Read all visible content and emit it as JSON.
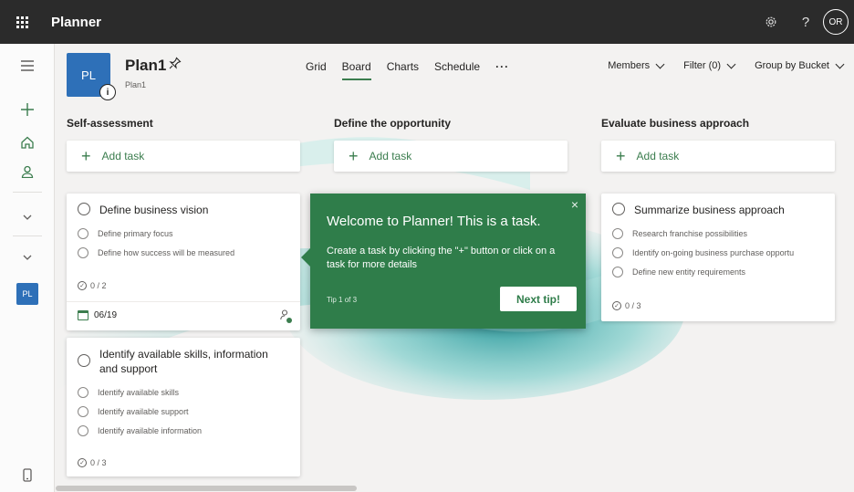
{
  "app": {
    "title": "Planner",
    "user_initials": "OR"
  },
  "topbar": {
    "settings_icon": "gear-icon",
    "help_icon": "?"
  },
  "leftrail": {
    "plan_badge": "PL"
  },
  "plan": {
    "tile": "PL",
    "name": "Plan1",
    "sub": "Plan1",
    "info_glyph": "i"
  },
  "tabs": [
    {
      "label": "Grid"
    },
    {
      "label": "Board"
    },
    {
      "label": "Charts"
    },
    {
      "label": "Schedule"
    }
  ],
  "tabs_more": "···",
  "header_right": {
    "members": "Members",
    "filter": "Filter (0)",
    "group_by": "Group by Bucket"
  },
  "buckets": [
    {
      "title": "Self-assessment",
      "add_task": "Add task",
      "cards": [
        {
          "title": "Define business vision",
          "checklist": [
            "Define primary focus",
            "Define how success will be measured"
          ],
          "progress": "0 / 2",
          "due": "06/19"
        },
        {
          "title": "Identify available skills, information and support",
          "checklist": [
            "Identify available skills",
            "Identify available support",
            "Identify available information"
          ],
          "progress": "0 / 3"
        }
      ]
    },
    {
      "title": "Define the opportunity",
      "add_task": "Add task",
      "cards": []
    },
    {
      "title": "Evaluate business approach",
      "add_task": "Add task",
      "cards": [
        {
          "title": "Summarize business approach",
          "checklist": [
            "Research franchise possibilities",
            "Identify on-going business purchase opportu",
            "Define new entity requirements"
          ],
          "progress": "0 / 3"
        }
      ]
    }
  ],
  "tip": {
    "title": "Welcome to Planner! This is a task.",
    "body": "Create a task by clicking the \"+\" button or click on a task for more details",
    "counter": "Tip 1 of 3",
    "next": "Next tip!",
    "close": "×"
  },
  "colors": {
    "accent": "#3b7d4e",
    "topbar": "#2b2b2b",
    "tile": "#2e70b8",
    "tip_bg": "#2f7d4a"
  }
}
